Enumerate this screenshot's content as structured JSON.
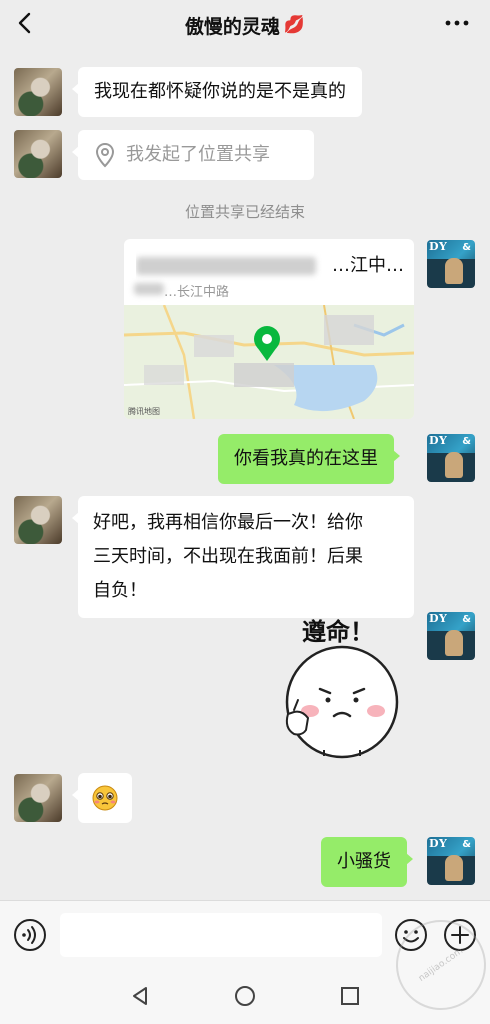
{
  "header": {
    "title": "傲慢的灵魂",
    "title_emoji": "💋"
  },
  "messages": {
    "m1": "我现在都怀疑你说的是不是真的",
    "m2": "我发起了位置共享",
    "system_note": "位置共享已经结束",
    "location_title": "…江中…",
    "location_subtitle": "…长江中路",
    "map_provider": "腾讯地图",
    "m4": "你看我真的在这里",
    "m5_line1": "好吧，我再相信你最后一次！给你",
    "m5_line2": "三天时间，不出现在我面前！后果",
    "m5_line3": "自负！",
    "sticker_text": "遵命！",
    "emoji_reply": "🥺",
    "m8": "小骚货"
  },
  "avatars": {
    "right_text": "DY",
    "right_symbol": "&"
  },
  "input": {
    "value": "",
    "placeholder": ""
  },
  "watermark": "naijiao.com",
  "colors": {
    "background": "#ededed",
    "sent_bubble": "#95ec69",
    "received_bubble": "#ffffff",
    "system_text": "#8e8e8e"
  },
  "icons": {
    "back": "chevron-left-icon",
    "more": "more-icon",
    "location": "location-pin-icon",
    "voice": "voice-icon",
    "emoji": "emoji-icon",
    "plus": "plus-icon"
  }
}
